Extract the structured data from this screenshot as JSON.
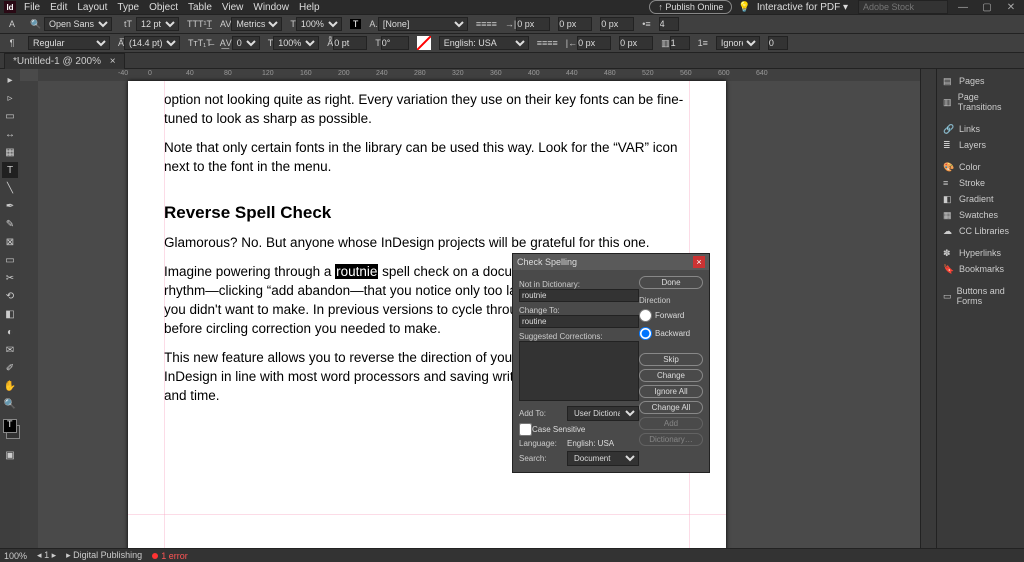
{
  "menu": {
    "items": [
      "File",
      "Edit",
      "Layout",
      "Type",
      "Object",
      "Table",
      "View",
      "Window",
      "Help"
    ]
  },
  "top_right": {
    "publish": "Publish Online",
    "workspace": "Interactive for PDF",
    "search_placeholder": "Adobe Stock"
  },
  "control": {
    "font_family": "Open Sans",
    "font_style": "Regular",
    "font_size": "12 pt",
    "leading": "(14.4 pt)",
    "metrics": "Metrics",
    "tracking": "0",
    "scale_h": "100%",
    "scale_v": "100%",
    "baseline": "0 pt",
    "skew": "0°",
    "para_style": "[None]",
    "language": "English: USA",
    "indent_left": "0 px",
    "indent_right": "0 px",
    "space_before": "0 px",
    "space_after": "0 px",
    "columns": "1",
    "hyphenate": "Ignore",
    "num_a": "4",
    "num_b": "0"
  },
  "tab": {
    "title": "*Untitled-1 @ 200%",
    "close": "×"
  },
  "ruler": {
    "marks": [
      "-40",
      "0",
      "40",
      "80",
      "120",
      "160",
      "200",
      "240",
      "280",
      "320",
      "360",
      "400",
      "440",
      "480",
      "520",
      "560",
      "600",
      "640"
    ]
  },
  "doc": {
    "p1": "option not looking quite as right. Every variation they use on their key fonts can be fine-tuned to look as sharp as possible.",
    "p2": "Note that only certain fonts in the library can be used this way. Look for the “VAR” icon next to the font in the menu.",
    "h1": "Reverse Spell Check",
    "p3": "Glamorous? No. But anyone whose InDesign projects will be grateful for this one.",
    "p4a": "Imagine powering through a ",
    "p4_bad": "routnie",
    "p4b": " spell check on a document. You get into such a rhythm—clicking “add abandon—that you notice only too late that you actually change you didn't want to make. In previous versions to cycle through the rest of the document before circling correction you needed to make.",
    "p5": "This new feature allows you to reverse the direction of your spell check, bringing InDesign in line with most word processors and saving writers and editors a lot of stress and time."
  },
  "dialog": {
    "title": "Check Spelling",
    "not_in_dict_label": "Not in Dictionary:",
    "not_in_dict_value": "routnie",
    "change_to_label": "Change To:",
    "change_to_value": "routine",
    "suggestions_label": "Suggested Corrections:",
    "done": "Done",
    "direction_label": "Direction",
    "forward": "Forward",
    "backward": "Backward",
    "skip": "Skip",
    "change": "Change",
    "ignore_all": "Ignore All",
    "change_all": "Change All",
    "add": "Add",
    "dictionary": "Dictionary…",
    "add_to_label": "Add To:",
    "add_to_value": "User Dictionary",
    "case_sensitive": "Case Sensitive",
    "language_label": "Language:",
    "language_value": "English: USA",
    "search_label": "Search:",
    "search_value": "Document"
  },
  "panels": {
    "pages": "Pages",
    "page_transitions": "Page Transitions",
    "links": "Links",
    "layers": "Layers",
    "color": "Color",
    "stroke": "Stroke",
    "gradient": "Gradient",
    "swatches": "Swatches",
    "cc_libraries": "CC Libraries",
    "hyperlinks": "Hyperlinks",
    "bookmarks": "Bookmarks",
    "buttons_forms": "Buttons and Forms"
  },
  "status": {
    "zoom": "100%",
    "page_nav": "1",
    "workspace": "Digital Publishing",
    "errors": "1 error"
  }
}
